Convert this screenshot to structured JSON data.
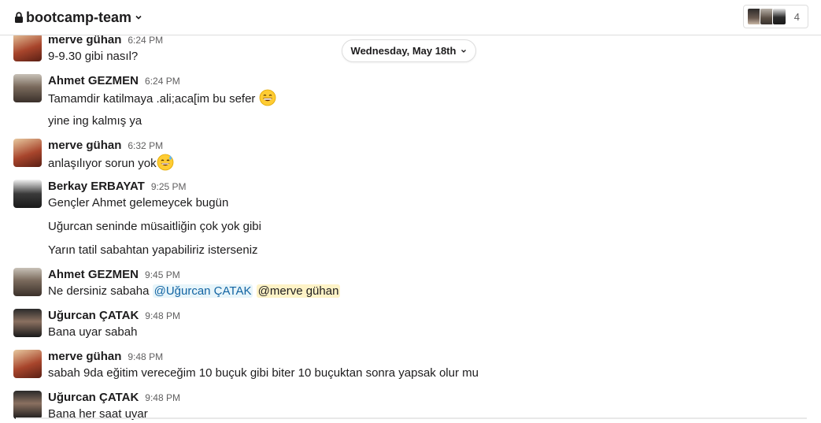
{
  "header": {
    "channel_name": "bootcamp-team",
    "member_count": "4"
  },
  "date_divider": {
    "label": "Wednesday, May 18th"
  },
  "messages": [
    {
      "sender": "merve gühan",
      "time": "6:24 PM",
      "lines": [
        "9-9.30 gibi nasıl?"
      ]
    },
    {
      "sender": "Ahmet GEZMEN",
      "time": "6:24 PM",
      "lines": [
        "Tamamdir katilmaya .ali;aca[im bu sefer",
        "yine ing kalmış ya"
      ],
      "emoji": "grinning-emoji"
    },
    {
      "sender": "merve gühan",
      "time": "6:32 PM",
      "lines": [
        "anlaşılıyor sorun yok"
      ],
      "emoji": "sweat-smile-emoji"
    },
    {
      "sender": "Berkay ERBAYAT",
      "time": "9:25 PM",
      "lines": [
        "Gençler Ahmet gelemeycek bugün",
        "Uğurcan seninde müsaitliğin çok yok gibi",
        "Yarın tatil sabahtan yapabiliriz isterseniz"
      ]
    },
    {
      "sender": "Ahmet GEZMEN",
      "time": "9:45 PM",
      "prefix": "Ne dersiniz sabaha",
      "mentions": [
        "@Uğurcan ÇATAK",
        "@merve gühan"
      ]
    },
    {
      "sender": "Uğurcan ÇATAK",
      "time": "9:48 PM",
      "lines": [
        "Bana uyar sabah"
      ]
    },
    {
      "sender": "merve gühan",
      "time": "9:48 PM",
      "lines": [
        "sabah 9da eğitim vereceğim 10 buçuk gibi biter 10 buçuktan sonra yapsak olur mu"
      ]
    },
    {
      "sender": "Uğurcan ÇATAK",
      "time": "9:48 PM",
      "lines": [
        "Bana her saat uyar"
      ]
    }
  ]
}
